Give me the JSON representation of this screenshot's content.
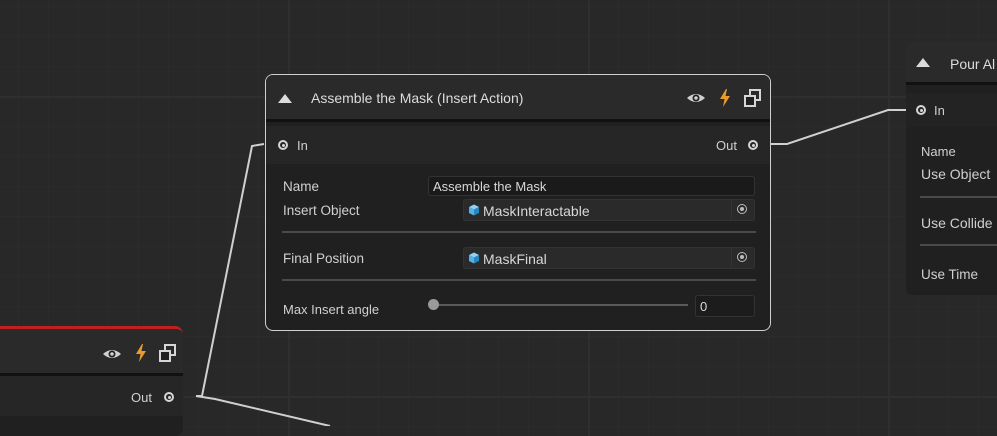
{
  "nodes": {
    "assemble": {
      "title": "Assemble the Mask (Insert Action)",
      "in_label": "In",
      "out_label": "Out",
      "name_label": "Name",
      "name_value": "Assemble the Mask",
      "insert_object_label": "Insert Object",
      "insert_object_value": "MaskInteractable",
      "final_position_label": "Final Position",
      "final_position_value": "MaskFinal",
      "max_angle_label": "Max Insert angle",
      "max_angle_value": "0",
      "max_angle_slider_fraction": 0
    },
    "pour": {
      "title": "Pour Al",
      "in_label": "In",
      "name_label": "Name",
      "use_object_label": "Use Object",
      "use_collider_label": "Use Collide",
      "use_time_label": "Use Time"
    },
    "left": {
      "out_label": "Out"
    }
  },
  "icons": {
    "visibility": "eye-icon",
    "trigger": "lightning-icon",
    "copy": "duplicate-icon",
    "object": "cube-icon"
  },
  "colors": {
    "accent_red": "#c02020",
    "lightning_orange": "#e89a2c",
    "cube_blue": "#4fb3e8"
  }
}
